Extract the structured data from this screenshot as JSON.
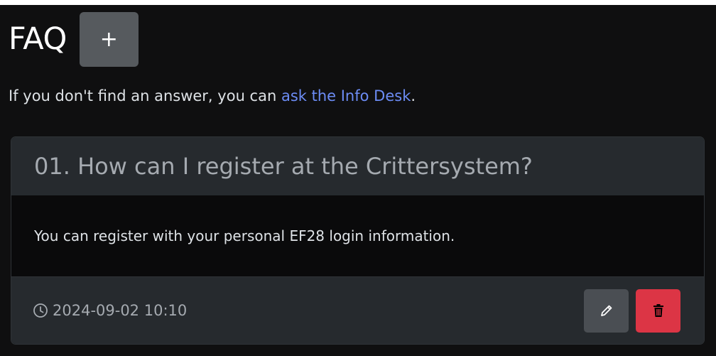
{
  "header": {
    "title": "FAQ",
    "add_label": "+"
  },
  "intro": {
    "text": "If you don't find an answer, you can ",
    "link_text": "ask the Info Desk",
    "suffix": "."
  },
  "faq_items": [
    {
      "question": "01. How can I register at the Crittersystem?",
      "answer": "You can register with your personal EF28 login information.",
      "timestamp": "2024-09-02 10:10"
    }
  ],
  "icons": {
    "add": "plus-icon",
    "time": "clock-icon",
    "edit": "pencil-icon",
    "delete": "trash-icon"
  },
  "colors": {
    "background": "#0f0f10",
    "card_header": "#262a2e",
    "link": "#6c8cf5",
    "delete": "#dc3545",
    "edit": "#4a4e53"
  }
}
